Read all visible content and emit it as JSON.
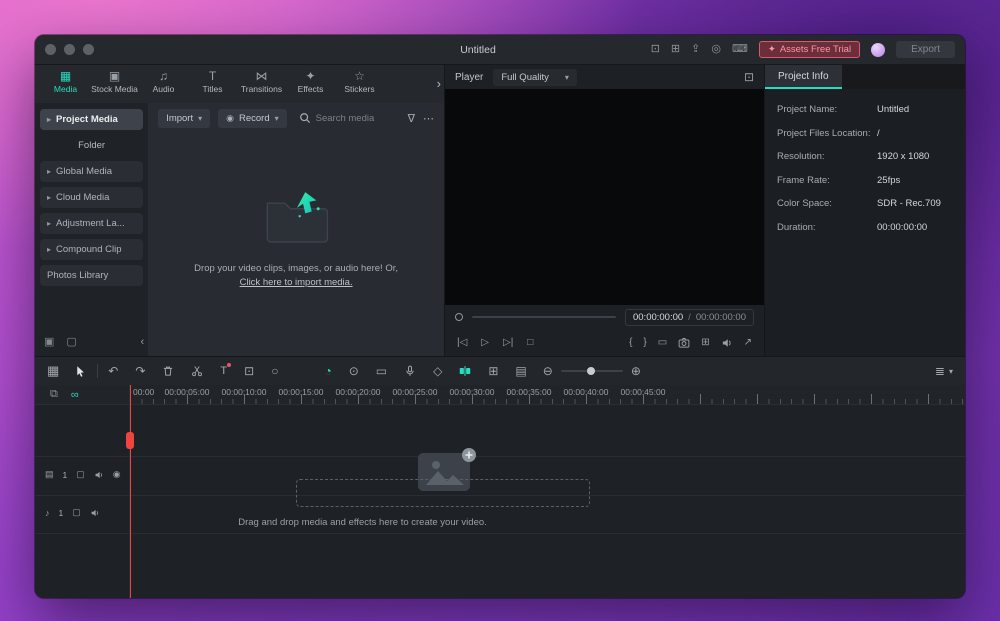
{
  "titlebar": {
    "title": "Untitled",
    "assets_label": "Assets Free Trial",
    "export_label": "Export"
  },
  "icons": {
    "display": "⊡",
    "apps": "⊞",
    "upload": "⇪",
    "help": "◎",
    "keyboard": "⌨",
    "gift": "✦",
    "tab_overflow": "›",
    "caret_down": "▾",
    "caret_right": "▸",
    "record_dot": "◉",
    "filter": "∇",
    "more": "⋯",
    "new_folder": "▣",
    "del_folder": "▢",
    "collapse": "‹",
    "player_pic": "⊡",
    "skip_back": "|◁",
    "play": "▷",
    "skip_fwd": "▷|",
    "stop": "□",
    "brace_l": "{",
    "brace_r": "}",
    "flag": "▭",
    "snapshot": "⊞",
    "expand": "↗",
    "blocks": "▦",
    "undo": "↶",
    "redo": "↷",
    "text_tool": "T",
    "crop": "⊡",
    "mask": "○",
    "speed": "◔",
    "compound": "⊙",
    "bookmark": "▭",
    "keyframe": "◇",
    "add_clip": "⊞",
    "render": "▤",
    "zoom_out": "⊖",
    "zoom_in": "⊕",
    "track_list": "≣",
    "copy": "⧉",
    "link": "∞",
    "film": "▤",
    "note": "♪",
    "folder_sm": "▢",
    "eye": "◉"
  },
  "media_tabs": [
    {
      "icon": "▦",
      "label": "Media"
    },
    {
      "icon": "▣",
      "label": "Stock Media"
    },
    {
      "icon": "♫",
      "label": "Audio"
    },
    {
      "icon": "T",
      "label": "Titles"
    },
    {
      "icon": "⋈",
      "label": "Transitions"
    },
    {
      "icon": "✦",
      "label": "Effects"
    },
    {
      "icon": "☆",
      "label": "Stickers"
    }
  ],
  "sidebar": {
    "items": [
      {
        "label": "Project Media"
      },
      {
        "label": "Folder"
      },
      {
        "label": "Global Media"
      },
      {
        "label": "Cloud Media"
      },
      {
        "label": "Adjustment La..."
      },
      {
        "label": "Compound Clip"
      },
      {
        "label": "Photos Library"
      }
    ]
  },
  "media_toolbar": {
    "import_label": "Import",
    "record_label": "Record",
    "search_placeholder": "Search media"
  },
  "dropzone": {
    "line1": "Drop your video clips, images, or audio here! Or,",
    "link": "Click here to import media."
  },
  "player": {
    "label": "Player",
    "quality": "Full Quality",
    "current_time": "00:00:00:00",
    "separator": "/",
    "total_time": "00:00:00:00"
  },
  "project_info": {
    "tab": "Project Info",
    "fields": [
      {
        "label": "Project Name:",
        "value": "Untitled"
      },
      {
        "label": "Project Files Location:",
        "value": "/"
      },
      {
        "label": "Resolution:",
        "value": "1920 x 1080"
      },
      {
        "label": "Frame Rate:",
        "value": "25fps"
      },
      {
        "label": "Color Space:",
        "value": "SDR - Rec.709"
      },
      {
        "label": "Duration:",
        "value": "00:00:00:00"
      }
    ]
  },
  "timeline": {
    "ruler": [
      "00:00",
      "00:00:05:00",
      "00:00:10:00",
      "00:00:15:00",
      "00:00:20:00",
      "00:00:25:00",
      "00:00:30:00",
      "00:00:35:00",
      "00:00:40:00",
      "00:00:45:00"
    ],
    "hint": "Drag and drop media and effects here to create your video.",
    "video_track_num": "1",
    "audio_track_num": "1"
  },
  "colors": {
    "teal": "#2adcc0",
    "pink": "#f2637a",
    "playhead": "#f0443f"
  }
}
